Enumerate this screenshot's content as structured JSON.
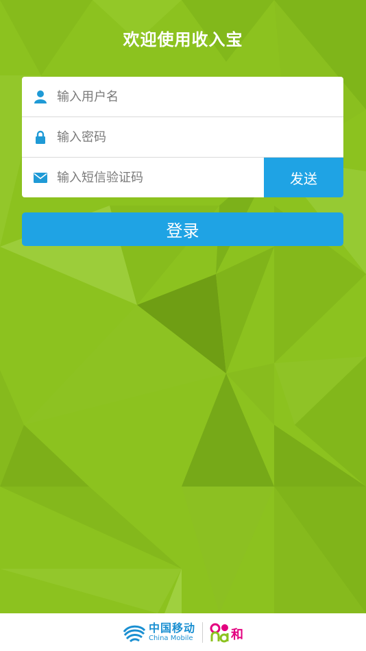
{
  "header": {
    "title": "欢迎使用收入宝"
  },
  "form": {
    "username": {
      "placeholder": "输入用户名",
      "value": "",
      "icon": "user-icon"
    },
    "password": {
      "placeholder": "输入密码",
      "value": "",
      "icon": "lock-icon"
    },
    "sms_code": {
      "placeholder": "输入短信验证码",
      "value": "",
      "icon": "envelope-icon"
    },
    "send_label": "发送"
  },
  "login": {
    "label": "登录"
  },
  "footer": {
    "brand_cn": "中国移动",
    "brand_en": "China Mobile",
    "and_brand": "and和"
  },
  "colors": {
    "background": "#8cc21f",
    "accent": "#1fa3e4",
    "white": "#ffffff",
    "brand_blue": "#1a8fd1",
    "brand_pink": "#e3007f"
  }
}
